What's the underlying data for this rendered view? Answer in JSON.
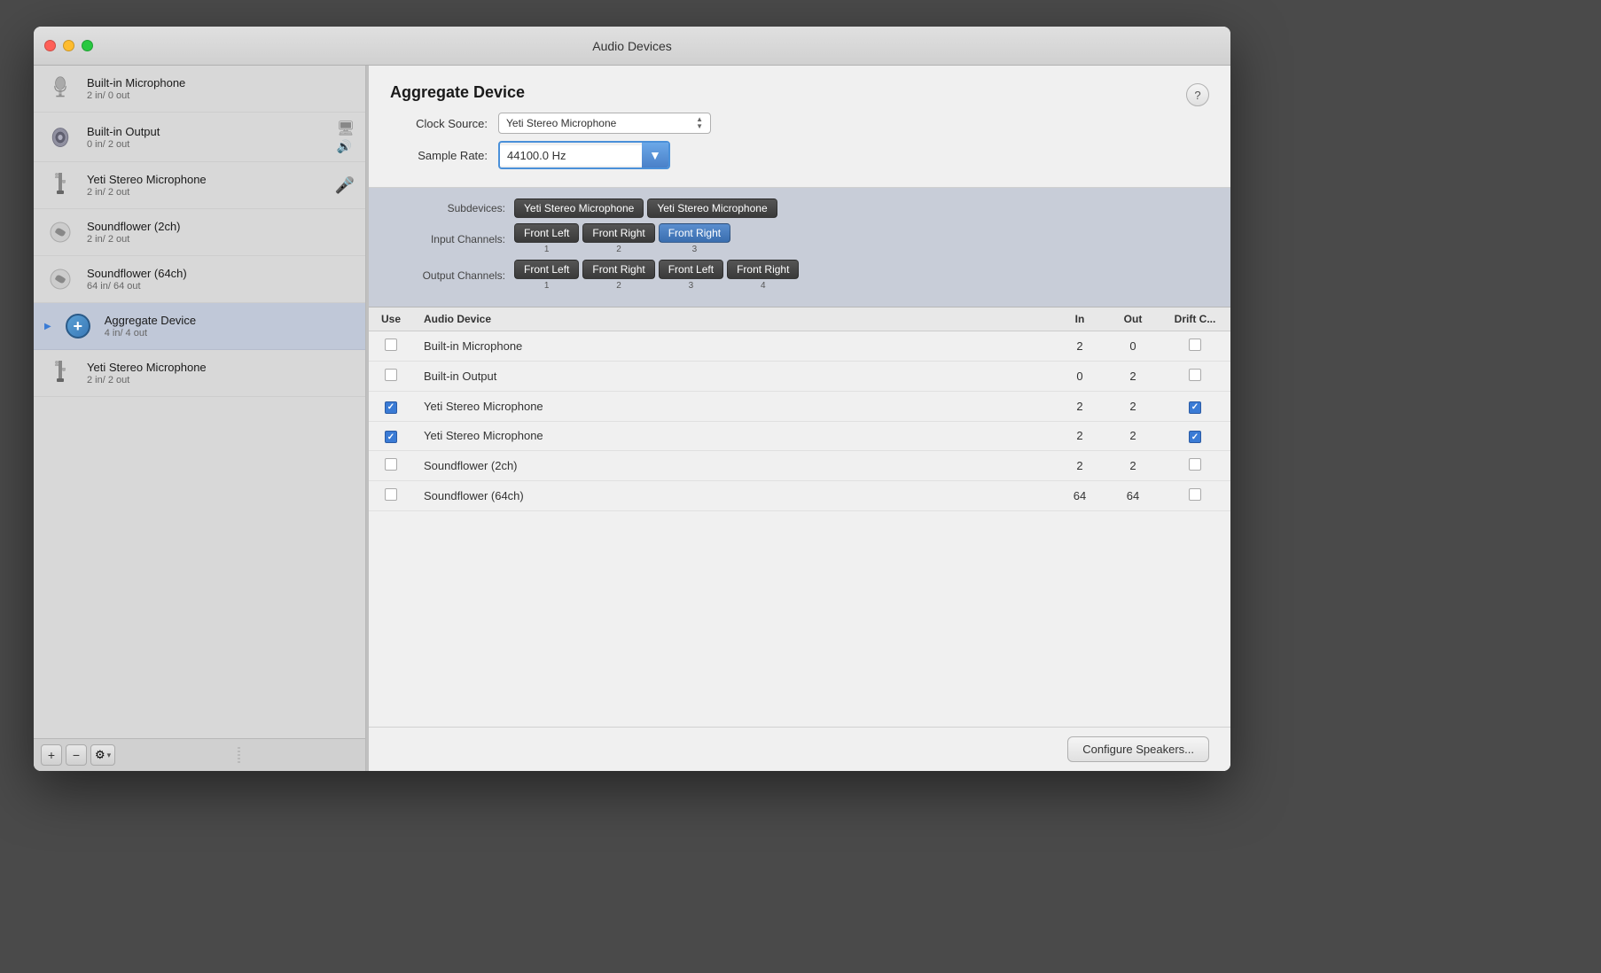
{
  "window": {
    "title": "Audio Devices"
  },
  "sidebar": {
    "items": [
      {
        "id": "builtin-microphone",
        "name": "Built-in Microphone",
        "sub": "2 in/ 0 out",
        "icon": "microphone",
        "selected": false,
        "badge": ""
      },
      {
        "id": "builtin-output",
        "name": "Built-in Output",
        "sub": "0 in/ 2 out",
        "icon": "speaker",
        "selected": false,
        "badge": "output"
      },
      {
        "id": "yeti-1",
        "name": "Yeti Stereo Microphone",
        "sub": "2 in/ 2 out",
        "icon": "usb",
        "selected": false,
        "badge": "input"
      },
      {
        "id": "soundflower-2ch",
        "name": "Soundflower (2ch)",
        "sub": "2 in/ 2 out",
        "icon": "soundflower",
        "selected": false,
        "badge": ""
      },
      {
        "id": "soundflower-64ch",
        "name": "Soundflower (64ch)",
        "sub": "64 in/ 64 out",
        "icon": "soundflower",
        "selected": false,
        "badge": ""
      },
      {
        "id": "aggregate",
        "name": "Aggregate Device",
        "sub": "4 in/ 4 out",
        "icon": "aggregate",
        "selected": true,
        "badge": ""
      },
      {
        "id": "yeti-2",
        "name": "Yeti Stereo Microphone",
        "sub": "2 in/ 2 out",
        "icon": "usb",
        "selected": false,
        "badge": ""
      }
    ],
    "footer": {
      "add": "+",
      "remove": "−",
      "gear": "⚙",
      "chevron": "▾"
    }
  },
  "main": {
    "aggregate": {
      "title": "Aggregate Device",
      "clock_source_label": "Clock Source:",
      "clock_source_value": "Yeti Stereo Microphone",
      "sample_rate_label": "Sample Rate:",
      "sample_rate_value": "44100.0 Hz",
      "help_label": "?"
    },
    "channels": {
      "subdevices_label": "Subdevices:",
      "subdevice_1": "Yeti Stereo Microphone",
      "subdevice_2": "Yeti Stereo Microphone",
      "input_label": "Input Channels:",
      "input_channels": [
        {
          "label": "Front Left",
          "num": "1",
          "style": "dark"
        },
        {
          "label": "Front Right",
          "num": "2",
          "style": "dark"
        },
        {
          "label": "Front Right",
          "num": "3",
          "style": "blue"
        }
      ],
      "output_label": "Output Channels:",
      "output_channels": [
        {
          "label": "Front Left",
          "num": "1",
          "style": "dark"
        },
        {
          "label": "Front Right",
          "num": "2",
          "style": "dark"
        },
        {
          "label": "Front Left",
          "num": "3",
          "style": "dark"
        },
        {
          "label": "Front Right",
          "num": "4",
          "style": "dark"
        }
      ]
    },
    "table": {
      "headers": [
        "Use",
        "Audio Device",
        "In",
        "Out",
        "Drift C..."
      ],
      "rows": [
        {
          "use": false,
          "name": "Built-in Microphone",
          "in": "2",
          "out": "0",
          "drift": false
        },
        {
          "use": false,
          "name": "Built-in Output",
          "in": "0",
          "out": "2",
          "drift": false
        },
        {
          "use": true,
          "name": "Yeti Stereo Microphone",
          "in": "2",
          "out": "2",
          "drift": true
        },
        {
          "use": true,
          "name": "Yeti Stereo Microphone",
          "in": "2",
          "out": "2",
          "drift": true
        },
        {
          "use": false,
          "name": "Soundflower (2ch)",
          "in": "2",
          "out": "2",
          "drift": false
        },
        {
          "use": false,
          "name": "Soundflower (64ch)",
          "in": "64",
          "out": "64",
          "drift": false
        }
      ]
    },
    "footer": {
      "configure_btn": "Configure Speakers..."
    }
  }
}
